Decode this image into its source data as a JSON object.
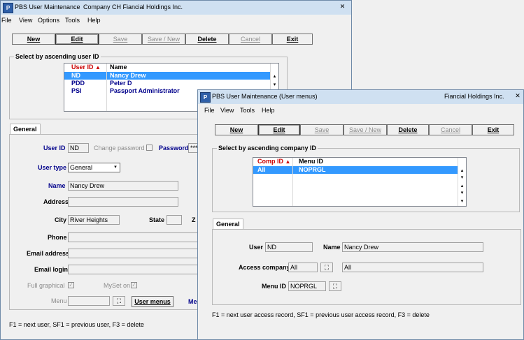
{
  "back": {
    "title_app": "PBS  User Maintenance",
    "title_company": "Company CH  Fiancial Holdings Inc.",
    "menu": [
      "File",
      "View",
      "Options",
      "Tools",
      "Help"
    ],
    "buttons": {
      "new": "New",
      "edit": "Edit",
      "save": "Save",
      "save_new": "Save / New",
      "delete": "Delete",
      "cancel": "Cancel",
      "exit": "Exit"
    },
    "list": {
      "title": "Select by ascending user ID",
      "col_user_id": "User ID",
      "col_name": "Name",
      "rows": [
        {
          "id": "ND",
          "name": "Nancy Drew"
        },
        {
          "id": "PDD",
          "name": "Peter D"
        },
        {
          "id": "PSI",
          "name": "Passport Administrator"
        }
      ]
    },
    "tab_general": "General",
    "form": {
      "user_id_label": "User ID",
      "user_id_value": "ND",
      "change_password_label": "Change password",
      "password_label": "Password",
      "password_value": "***",
      "user_type_label": "User type",
      "user_type_value": "General",
      "name_label": "Name",
      "name_value": "Nancy Drew",
      "address_label": "Address",
      "city_label": "City",
      "city_value": "River Heights",
      "state_label": "State",
      "zip_label": "Z",
      "phone_label": "Phone",
      "email_label": "Email address",
      "email_login_label": "Email login",
      "full_graphical_label": "Full graphical",
      "full_graphical_mark": "✓",
      "myset_label": "MySet on",
      "myset_mark": "✓",
      "menu_label": "Menu",
      "user_menus_button": "User menus",
      "me_label": "Me"
    },
    "status": "F1 = next user, SF1 = previous user, F3 = delete"
  },
  "front": {
    "title_app": "PBS  User Maintenance (User menus)",
    "title_company": "Fiancial Holdings Inc.",
    "menu": [
      "File",
      "View",
      "Tools",
      "Help"
    ],
    "buttons": {
      "new": "New",
      "edit": "Edit",
      "save": "Save",
      "save_new": "Save / New",
      "delete": "Delete",
      "cancel": "Cancel",
      "exit": "Exit"
    },
    "list": {
      "title": "Select by ascending company ID",
      "col_comp_id": "Comp ID",
      "col_menu_id": "Menu ID",
      "rows": [
        {
          "comp": "All",
          "menu": "NOPRGL"
        }
      ]
    },
    "tab_general": "General",
    "form": {
      "user_label": "User",
      "user_value": "ND",
      "name_label": "Name",
      "name_value": "Nancy Drew",
      "access_company_label": "Access company",
      "access_company_value": "All",
      "access_company_name": "All",
      "menu_id_label": "Menu ID",
      "menu_id_value": "NOPRGL"
    },
    "status": "F1 = next user access record, SF1 = previous user access record, F3 = delete"
  },
  "icons": {
    "sort": "▲",
    "binoculars": "⛶",
    "close": "✕",
    "scroll_up": "▴",
    "scroll_down": "▾"
  },
  "colors": {
    "label_blue": "#00008b",
    "selection": "#3399ff",
    "sort_red": "#cc0000"
  }
}
